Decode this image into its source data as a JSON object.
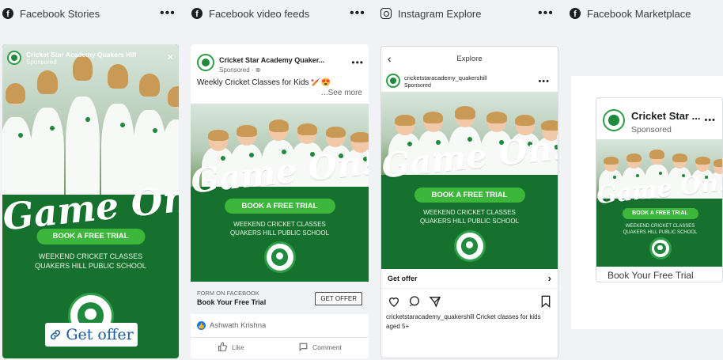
{
  "columns": [
    {
      "title": "Facebook Stories",
      "icon": "facebook-icon",
      "has_more": true
    },
    {
      "title": "Facebook video feeds",
      "icon": "facebook-icon",
      "has_more": true
    },
    {
      "title": "Instagram Explore",
      "icon": "instagram-icon",
      "has_more": true
    },
    {
      "title": "Facebook Marketplace",
      "icon": "facebook-icon",
      "has_more": false
    }
  ],
  "creative": {
    "headline": "Game On!",
    "cta": "BOOK A FREE TRIAL",
    "sub": "WEEKEND CRICKET CLASSES\nQUAKERS HILL PUBLIC SCHOOL"
  },
  "story": {
    "page_name": "Cricket Star Academy Quakers Hill",
    "sponsored": "Sponsored",
    "close": "✕",
    "cta_label": "Get offer",
    "cta_icon": "link-icon"
  },
  "feed": {
    "page_name": "Cricket Star Academy Quaker...",
    "sponsored": "Sponsored · ⊕",
    "caption": "Weekly Cricket Classes for Kids 🏏😍",
    "see_more": "...See more",
    "form_label": "FORM ON FACEBOOK",
    "form_title": "Book Your Free Trial",
    "form_button": "GET OFFER",
    "reaction_name": "Ashwath Krishna",
    "like": "Like",
    "comment": "Comment"
  },
  "ig": {
    "title": "Explore",
    "handle": "cricketstaracademy_quakershill",
    "sponsored": "Sponsored",
    "get_offer": "Get offer",
    "caption_handle": "cricketstaracademy_quakershill",
    "caption_text": " Cricket classes for kids aged 5+"
  },
  "marketplace": {
    "page_name": "Cricket Star ...",
    "sponsored": "Sponsored",
    "footer": "Book Your Free Trial"
  },
  "colors": {
    "brand_green": "#15712d",
    "cta_green": "#3cb73c",
    "fb_blue": "#1877f2"
  }
}
